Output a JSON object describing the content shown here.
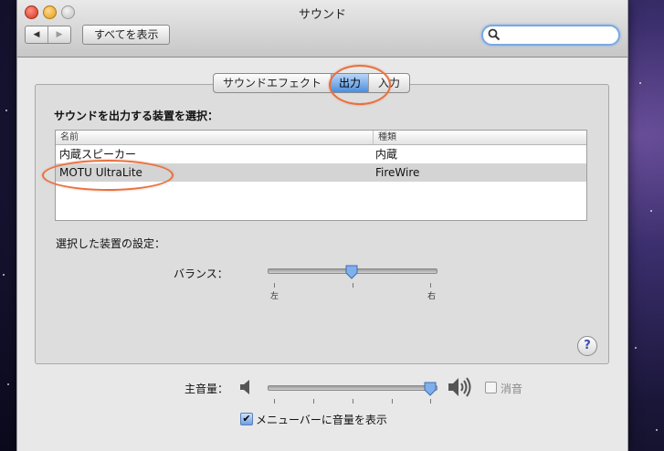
{
  "window": {
    "title": "サウンド",
    "show_all_label": "すべてを表示",
    "back_arrow": "◀",
    "forward_arrow": "▶",
    "search": {
      "value": "",
      "placeholder": ""
    }
  },
  "tabs": [
    {
      "label": "サウンドエフェクト",
      "active": false
    },
    {
      "label": "出力",
      "active": true
    },
    {
      "label": "入力",
      "active": false
    }
  ],
  "output": {
    "section_title": "サウンドを出力する装置を選択：",
    "columns": [
      "名前",
      "種類"
    ],
    "devices": [
      {
        "name": "内蔵スピーカー",
        "type": "内蔵",
        "selected": false
      },
      {
        "name": "MOTU UltraLite",
        "type": "FireWire",
        "selected": true
      }
    ],
    "settings_label": "選択した装置の設定：",
    "balance": {
      "label": "バランス：",
      "left_label": "左",
      "right_label": "右",
      "value": 0.5
    }
  },
  "volume": {
    "label": "主音量：",
    "level": 0.97,
    "mute_label": "消音",
    "muted": false,
    "show_in_menu_label": "メニューバーに音量を表示",
    "show_in_menu": true
  },
  "help_label": "?",
  "colors": {
    "highlight_circle": "#e8703e",
    "selection_blue": "#4a8ee0"
  }
}
